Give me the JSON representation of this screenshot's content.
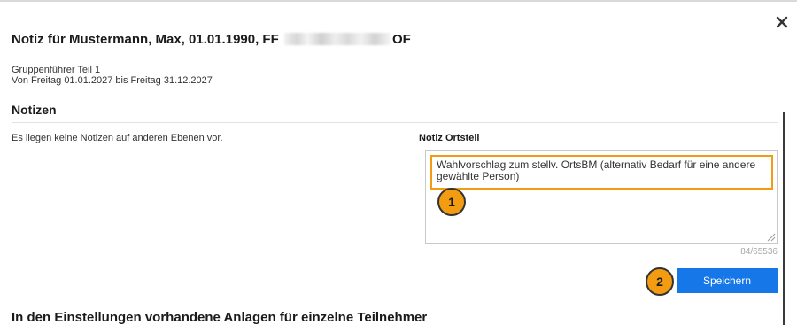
{
  "dialog": {
    "title_prefix": "Notiz für Mustermann, Max, 01.01.1990, FF",
    "title_suffix": "OF",
    "close_icon": "close-icon"
  },
  "meta": {
    "group": "Gruppenführer Teil 1",
    "period": "Von Freitag 01.01.2027 bis Freitag 31.12.2027"
  },
  "notes": {
    "heading": "Notizen",
    "no_notes_text": "Es liegen keine Notizen auf anderen Ebenen vor.",
    "label": "Notiz Ortsteil",
    "value": "Wahlvorschlag zum stellv. OrtsBM (alternativ Bedarf für eine andere gewählte Person)",
    "counter": "84/65536"
  },
  "steps": [
    "1",
    "2"
  ],
  "actions": {
    "save_label": "Speichern"
  },
  "attachments": {
    "heading": "In den Einstellungen vorhandene Anlagen für einzelne Teilnehmer"
  },
  "colors": {
    "accent_orange": "#f39c12",
    "button_blue": "#1677e8"
  }
}
